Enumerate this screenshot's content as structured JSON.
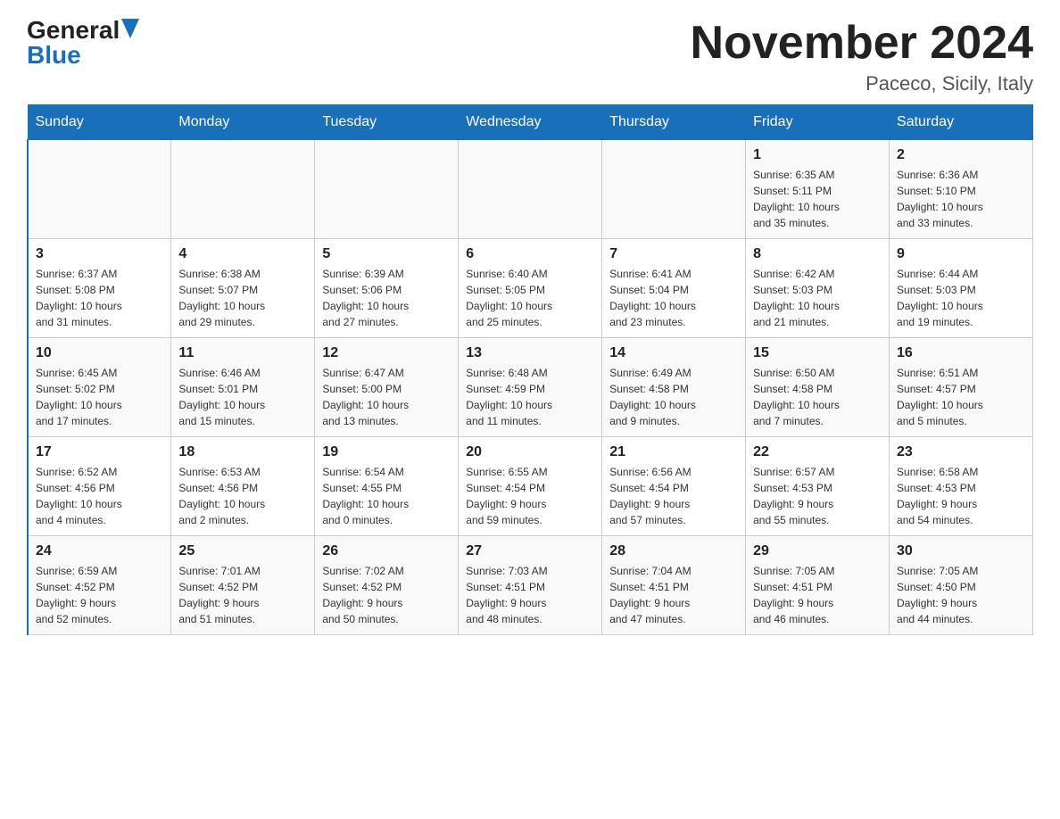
{
  "header": {
    "logo_general": "General",
    "logo_blue": "Blue",
    "month_title": "November 2024",
    "location": "Paceco, Sicily, Italy"
  },
  "days_of_week": [
    "Sunday",
    "Monday",
    "Tuesday",
    "Wednesday",
    "Thursday",
    "Friday",
    "Saturday"
  ],
  "weeks": [
    [
      {
        "day": "",
        "info": ""
      },
      {
        "day": "",
        "info": ""
      },
      {
        "day": "",
        "info": ""
      },
      {
        "day": "",
        "info": ""
      },
      {
        "day": "",
        "info": ""
      },
      {
        "day": "1",
        "info": "Sunrise: 6:35 AM\nSunset: 5:11 PM\nDaylight: 10 hours\nand 35 minutes."
      },
      {
        "day": "2",
        "info": "Sunrise: 6:36 AM\nSunset: 5:10 PM\nDaylight: 10 hours\nand 33 minutes."
      }
    ],
    [
      {
        "day": "3",
        "info": "Sunrise: 6:37 AM\nSunset: 5:08 PM\nDaylight: 10 hours\nand 31 minutes."
      },
      {
        "day": "4",
        "info": "Sunrise: 6:38 AM\nSunset: 5:07 PM\nDaylight: 10 hours\nand 29 minutes."
      },
      {
        "day": "5",
        "info": "Sunrise: 6:39 AM\nSunset: 5:06 PM\nDaylight: 10 hours\nand 27 minutes."
      },
      {
        "day": "6",
        "info": "Sunrise: 6:40 AM\nSunset: 5:05 PM\nDaylight: 10 hours\nand 25 minutes."
      },
      {
        "day": "7",
        "info": "Sunrise: 6:41 AM\nSunset: 5:04 PM\nDaylight: 10 hours\nand 23 minutes."
      },
      {
        "day": "8",
        "info": "Sunrise: 6:42 AM\nSunset: 5:03 PM\nDaylight: 10 hours\nand 21 minutes."
      },
      {
        "day": "9",
        "info": "Sunrise: 6:44 AM\nSunset: 5:03 PM\nDaylight: 10 hours\nand 19 minutes."
      }
    ],
    [
      {
        "day": "10",
        "info": "Sunrise: 6:45 AM\nSunset: 5:02 PM\nDaylight: 10 hours\nand 17 minutes."
      },
      {
        "day": "11",
        "info": "Sunrise: 6:46 AM\nSunset: 5:01 PM\nDaylight: 10 hours\nand 15 minutes."
      },
      {
        "day": "12",
        "info": "Sunrise: 6:47 AM\nSunset: 5:00 PM\nDaylight: 10 hours\nand 13 minutes."
      },
      {
        "day": "13",
        "info": "Sunrise: 6:48 AM\nSunset: 4:59 PM\nDaylight: 10 hours\nand 11 minutes."
      },
      {
        "day": "14",
        "info": "Sunrise: 6:49 AM\nSunset: 4:58 PM\nDaylight: 10 hours\nand 9 minutes."
      },
      {
        "day": "15",
        "info": "Sunrise: 6:50 AM\nSunset: 4:58 PM\nDaylight: 10 hours\nand 7 minutes."
      },
      {
        "day": "16",
        "info": "Sunrise: 6:51 AM\nSunset: 4:57 PM\nDaylight: 10 hours\nand 5 minutes."
      }
    ],
    [
      {
        "day": "17",
        "info": "Sunrise: 6:52 AM\nSunset: 4:56 PM\nDaylight: 10 hours\nand 4 minutes."
      },
      {
        "day": "18",
        "info": "Sunrise: 6:53 AM\nSunset: 4:56 PM\nDaylight: 10 hours\nand 2 minutes."
      },
      {
        "day": "19",
        "info": "Sunrise: 6:54 AM\nSunset: 4:55 PM\nDaylight: 10 hours\nand 0 minutes."
      },
      {
        "day": "20",
        "info": "Sunrise: 6:55 AM\nSunset: 4:54 PM\nDaylight: 9 hours\nand 59 minutes."
      },
      {
        "day": "21",
        "info": "Sunrise: 6:56 AM\nSunset: 4:54 PM\nDaylight: 9 hours\nand 57 minutes."
      },
      {
        "day": "22",
        "info": "Sunrise: 6:57 AM\nSunset: 4:53 PM\nDaylight: 9 hours\nand 55 minutes."
      },
      {
        "day": "23",
        "info": "Sunrise: 6:58 AM\nSunset: 4:53 PM\nDaylight: 9 hours\nand 54 minutes."
      }
    ],
    [
      {
        "day": "24",
        "info": "Sunrise: 6:59 AM\nSunset: 4:52 PM\nDaylight: 9 hours\nand 52 minutes."
      },
      {
        "day": "25",
        "info": "Sunrise: 7:01 AM\nSunset: 4:52 PM\nDaylight: 9 hours\nand 51 minutes."
      },
      {
        "day": "26",
        "info": "Sunrise: 7:02 AM\nSunset: 4:52 PM\nDaylight: 9 hours\nand 50 minutes."
      },
      {
        "day": "27",
        "info": "Sunrise: 7:03 AM\nSunset: 4:51 PM\nDaylight: 9 hours\nand 48 minutes."
      },
      {
        "day": "28",
        "info": "Sunrise: 7:04 AM\nSunset: 4:51 PM\nDaylight: 9 hours\nand 47 minutes."
      },
      {
        "day": "29",
        "info": "Sunrise: 7:05 AM\nSunset: 4:51 PM\nDaylight: 9 hours\nand 46 minutes."
      },
      {
        "day": "30",
        "info": "Sunrise: 7:05 AM\nSunset: 4:50 PM\nDaylight: 9 hours\nand 44 minutes."
      }
    ]
  ]
}
